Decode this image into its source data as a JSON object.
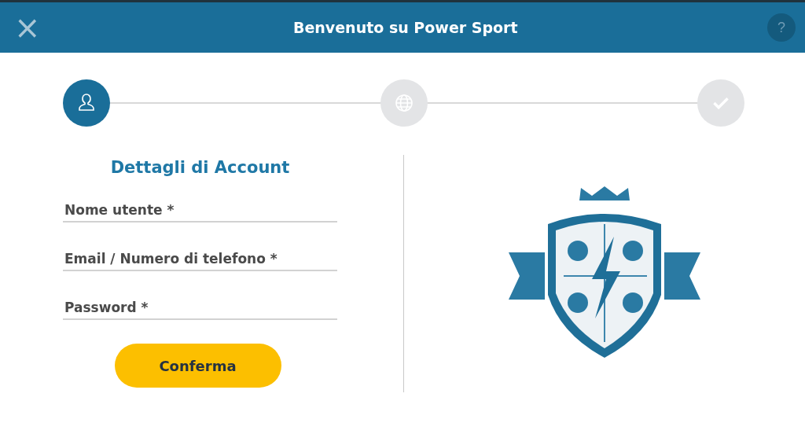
{
  "header": {
    "close": "×",
    "title": "Benvenuto su Power Sport",
    "help": "?"
  },
  "steps": [
    {
      "kind": "user",
      "selected": true
    },
    {
      "kind": "globe",
      "selected": false
    },
    {
      "kind": "check",
      "selected": false
    }
  ],
  "form": {
    "title": "Dettagli di Account",
    "fields": [
      {
        "placeholder": "Nome utente *"
      },
      {
        "placeholder": "Email / Numero di telefono *"
      },
      {
        "placeholder": "Password *"
      }
    ],
    "submit": "Conferma"
  }
}
